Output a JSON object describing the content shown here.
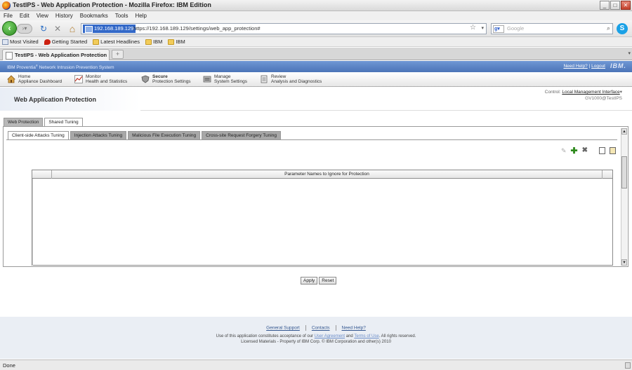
{
  "window": {
    "title": "TestIPS - Web Application Protection - Mozilla Firefox: IBM Edition",
    "min_glyph": "_",
    "max_glyph": "□",
    "close_glyph": "✕"
  },
  "menu": [
    "File",
    "Edit",
    "View",
    "History",
    "Bookmarks",
    "Tools",
    "Help"
  ],
  "nav": {
    "back_glyph": "‹",
    "fwd_glyph": "›▾",
    "reload_glyph": "↻",
    "stop_glyph": "✕",
    "home_glyph": "⌂",
    "url_host": "192.168.189.129",
    "url": "https://192.168.189.129/settings/web_app_protection#",
    "star_glyph": "☆",
    "search_placeholder": "Google",
    "search_engine_glyph": "g▾",
    "search_go_glyph": "⌕",
    "skype_glyph": "S"
  },
  "bookmarks": [
    {
      "label": "Most Visited",
      "icon": "page"
    },
    {
      "label": "Getting Started",
      "icon": "rss"
    },
    {
      "label": "Latest Headlines",
      "icon": "folder"
    },
    {
      "label": "IBM",
      "icon": "folder"
    },
    {
      "label": "IBM",
      "icon": "folder"
    }
  ],
  "tabs": {
    "active_label": "TestIPS - Web Application Protection",
    "new_tab_glyph": "+",
    "scroll_glyph": "▾"
  },
  "app": {
    "product": "IBM Proventia",
    "product_reg": "®",
    "product_suffix": " Network Intrusion Prevention System",
    "need_help": "Need Help?",
    "sep": " | ",
    "logout": "Logout",
    "ibm": "IBM."
  },
  "appnav": [
    {
      "title": "Home",
      "subtitle": "Appliance Dashboard",
      "icon": "home-icon",
      "color": "#c88a2a"
    },
    {
      "title": "Monitor",
      "subtitle": "Health and Statistics",
      "icon": "chart-icon",
      "color": "#c0392b"
    },
    {
      "title": "Secure",
      "subtitle": "Protection Settings",
      "icon": "shield-icon",
      "color": "#6c6c6c"
    },
    {
      "title": "Manage",
      "subtitle": "System Settings",
      "icon": "gear-icon",
      "color": "#808080"
    },
    {
      "title": "Review",
      "subtitle": "Analysis and Diagnostics",
      "icon": "report-icon",
      "color": "#7a7a7a"
    }
  ],
  "page": {
    "title": "Web Application Protection",
    "control_label": "Control:",
    "control_value": "Local Management Interface",
    "control_caret": "▾",
    "device": "GV1000@TestIPS"
  },
  "main_tabs": [
    {
      "label": "Web Protection",
      "active": false
    },
    {
      "label": "Shared Tuning",
      "active": true
    }
  ],
  "sub_tabs": [
    {
      "label": "Client-side Attacks Tuning",
      "active": true
    },
    {
      "label": "Injection Attacks Tuning",
      "active": false
    },
    {
      "label": "Malicious File Execution Tuning",
      "active": false
    },
    {
      "label": "Cross-site Request Forgery Tuning",
      "active": false
    }
  ],
  "toolbar": {
    "edit_glyph": "✎",
    "add_glyph": "✚",
    "delete_glyph": "✖"
  },
  "grid": {
    "column": "Parameter Names to Ignore for Protection"
  },
  "scroll": {
    "up": "▲",
    "down": "▼"
  },
  "buttons": {
    "apply": "Apply",
    "reset": "Reset"
  },
  "footer": {
    "links": [
      "General Support",
      "Contacts",
      "Need Help?"
    ],
    "line1_pre": "Use of this application constitutes acceptance of our ",
    "user_agreement": "User Agreement",
    "and": " and ",
    "terms": "Terms of Use",
    "line1_post": ". All rights reserved.",
    "line2": "Licensed Materials - Property of IBM Corp. © IBM Corporation and other(s) 2010"
  },
  "status": "Done"
}
